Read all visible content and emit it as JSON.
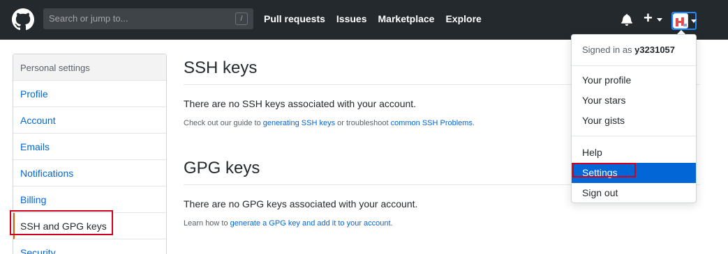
{
  "header": {
    "search_placeholder": "Search or jump to...",
    "search_shortcut": "/",
    "nav": [
      "Pull requests",
      "Issues",
      "Marketplace",
      "Explore"
    ],
    "plus_label": "+"
  },
  "sidebar": {
    "title": "Personal settings",
    "items": [
      "Profile",
      "Account",
      "Emails",
      "Notifications",
      "Billing",
      "SSH and GPG keys",
      "Security"
    ],
    "selected": "SSH and GPG keys"
  },
  "main": {
    "ssh": {
      "title": "SSH keys",
      "empty_text": "There are no SSH keys associated with your account.",
      "note_prefix": "Check out our guide to ",
      "link1": "generating SSH keys",
      "note_mid": " or troubleshoot ",
      "link2": "common SSH Problems",
      "note_suffix": "."
    },
    "gpg": {
      "title": "GPG keys",
      "empty_text": "There are no GPG keys associated with your account.",
      "note_prefix": "Learn how to ",
      "link": "generate a GPG key and add it to your account",
      "note_suffix": "."
    }
  },
  "dropdown": {
    "signed_in_prefix": "Signed in as ",
    "username": "y3231057",
    "group1": [
      "Your profile",
      "Your stars",
      "Your gists"
    ],
    "group2": [
      "Help",
      "Settings",
      "Sign out"
    ],
    "active": "Settings"
  },
  "colors": {
    "header_bg": "#24292e",
    "link": "#0366d6",
    "highlight": "#d0021b",
    "active_item": "#0366d6"
  }
}
